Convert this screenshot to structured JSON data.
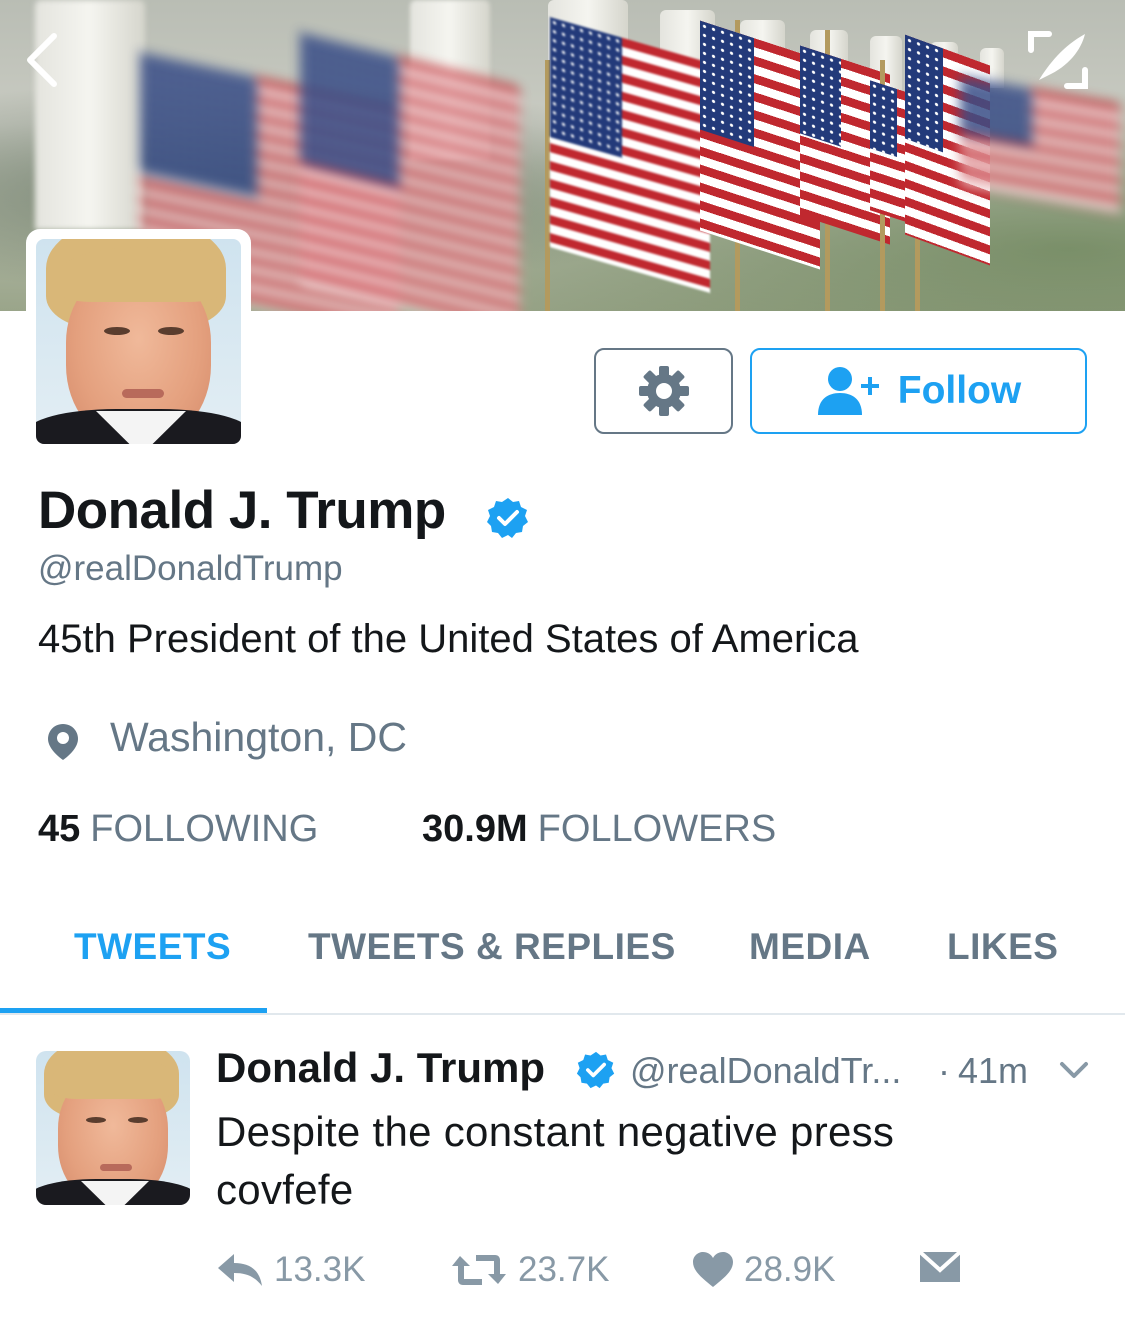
{
  "header": {
    "back_icon": "chevron-left-icon",
    "compose_icon": "compose-tweet-icon"
  },
  "profile": {
    "name": "Donald J. Trump",
    "verified": true,
    "handle": "@realDonaldTrump",
    "bio": "45th President of the United States of America",
    "location": "Washington, DC",
    "location_icon": "map-pin-icon",
    "following_count": "45",
    "following_label": "FOLLOWING",
    "followers_count": "30.9M",
    "followers_label": "FOLLOWERS"
  },
  "actions": {
    "settings_icon": "gear-icon",
    "follow_label": "Follow",
    "follow_icon": "add-user-icon"
  },
  "tabs": [
    {
      "label": "TWEETS",
      "active": true
    },
    {
      "label": "TWEETS & REPLIES",
      "active": false
    },
    {
      "label": "MEDIA",
      "active": false
    },
    {
      "label": "LIKES",
      "active": false
    }
  ],
  "tweet": {
    "name": "Donald J. Trump",
    "handle": "@realDonaldTr...",
    "separator": "·",
    "time": "41m",
    "text_line1": "Despite the constant negative press",
    "text_line2": "covfefe",
    "replies": "13.3K",
    "retweets": "23.7K",
    "likes": "28.9K"
  },
  "colors": {
    "accent": "#1da1f2",
    "secondary_text": "#657786",
    "action_gray": "#8899a6",
    "primary_text": "#14171a"
  }
}
